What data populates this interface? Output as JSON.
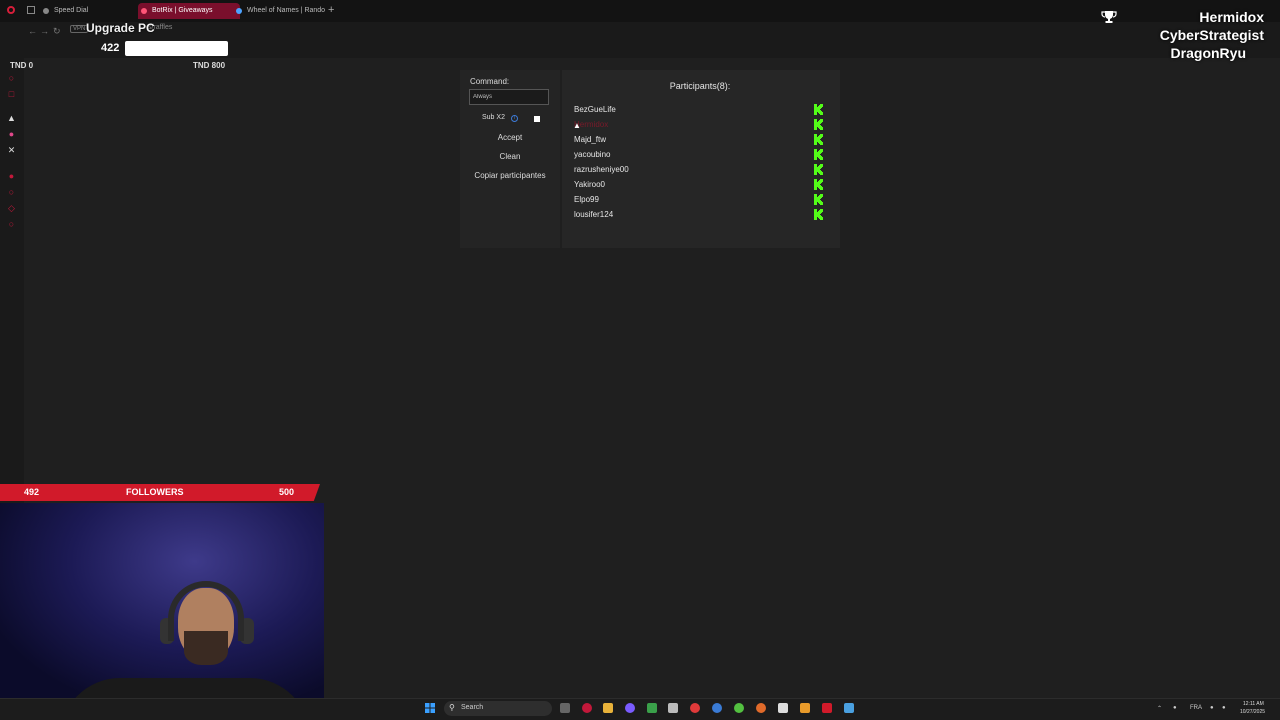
{
  "browser": {
    "tabs": [
      {
        "label": "Speed Dial",
        "active": false
      },
      {
        "label": "BotRix | Giveaways",
        "active": true
      },
      {
        "label": "Wheel of Names | Rando",
        "active": false
      }
    ],
    "url_fragment": "s/raffles",
    "vpn_label": "VPN"
  },
  "stream_overlay": {
    "goal_title": "Upgrade PC",
    "goal_value": "422",
    "currency_start": "TND 0",
    "currency_end": "TND 800",
    "names": [
      "Hermidox",
      "CyberStrategist",
      "DragonRyu"
    ],
    "followers": {
      "current": "492",
      "label": "FOLLOWERS",
      "target": "500"
    }
  },
  "app": {
    "command_label": "Command:",
    "command_value": "Always",
    "sub_label": "Sub X2",
    "sub_info_icon": "info-icon",
    "buttons": {
      "accept": "Accept",
      "clean": "Clean",
      "copy": "Copiar participantes"
    },
    "participants_title": "Participants(8):",
    "participants": [
      {
        "name": "BezGueLife",
        "faded": false
      },
      {
        "name": "Hermidox",
        "faded": true
      },
      {
        "name": "Majd_ftw",
        "faded": false
      },
      {
        "name": "yacoubino",
        "faded": false
      },
      {
        "name": "razrusheniye00",
        "faded": false
      },
      {
        "name": "Yakiroo0",
        "faded": false
      },
      {
        "name": "Elpo99",
        "faded": false
      },
      {
        "name": "lousifer124",
        "faded": false
      }
    ],
    "platform_icon": "kick-logo-icon",
    "platform_color": "#53fc18"
  },
  "taskbar": {
    "search_placeholder": "Search",
    "language": "FRA",
    "time": "12:11 AM",
    "date": "10/27/2025"
  },
  "colors": {
    "accent": "#d11a2a",
    "kick_green": "#53fc18",
    "background": "#1f1f1f"
  }
}
